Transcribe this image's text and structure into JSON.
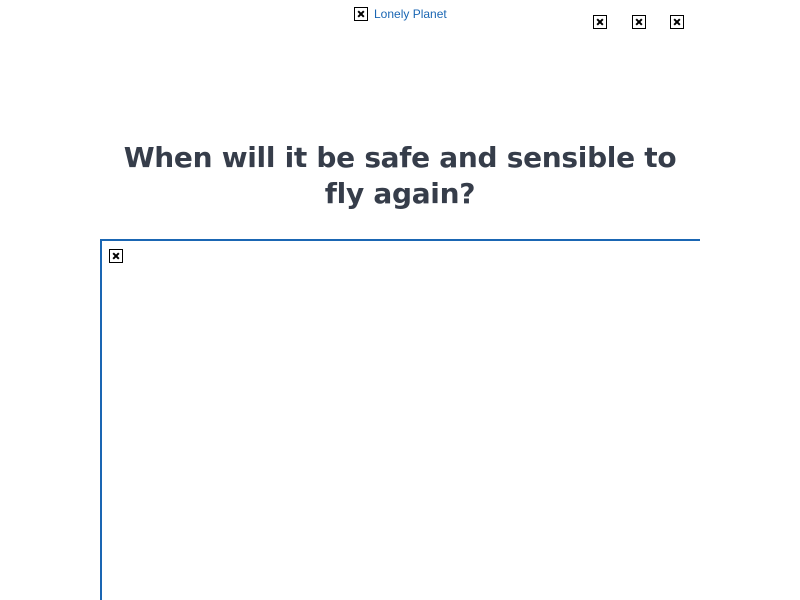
{
  "header": {
    "logo_alt": "Lonely Planet"
  },
  "social": {
    "icons": [
      "facebook-icon",
      "twitter-icon",
      "email-icon"
    ]
  },
  "article": {
    "title": "When will it be safe and sensible to fly again?"
  },
  "colors": {
    "link": "#1a66b3",
    "headline": "#363d4a",
    "frame_border": "#1a66b3"
  }
}
